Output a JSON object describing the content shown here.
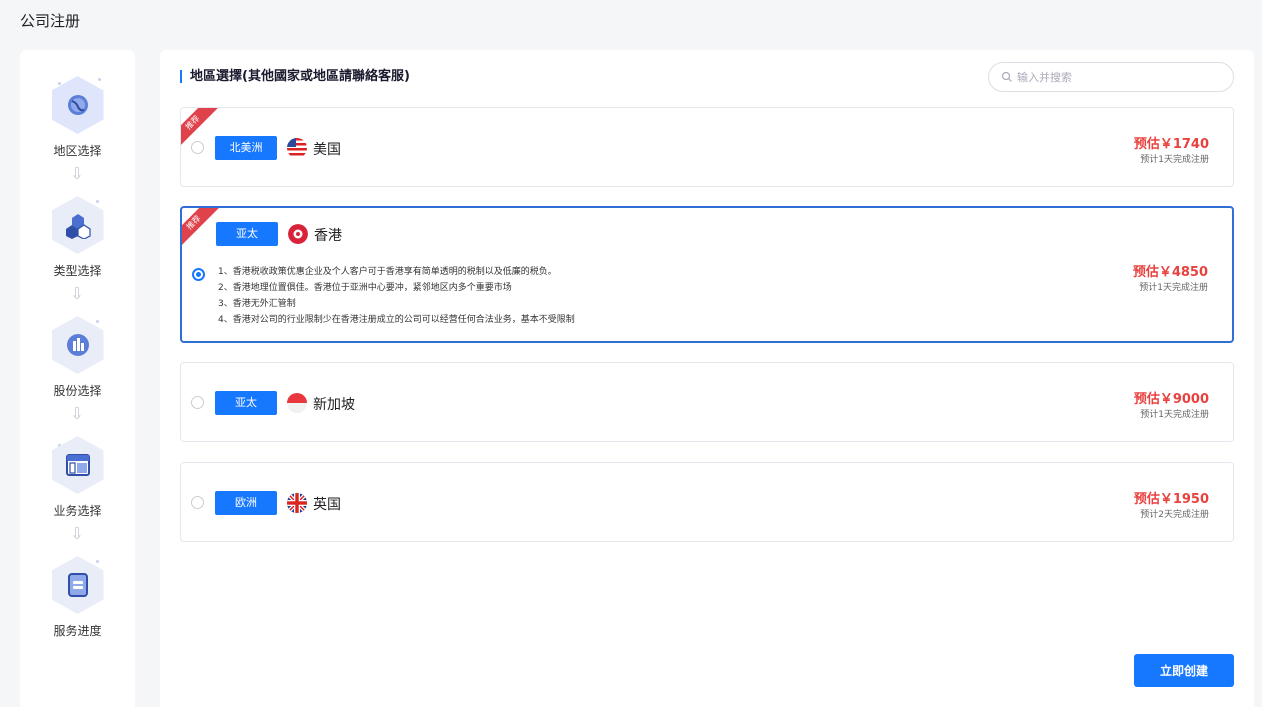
{
  "page": {
    "title": "公司注册"
  },
  "steps": [
    {
      "label": "地区选择",
      "icon": "region-icon"
    },
    {
      "label": "类型选择",
      "icon": "type-icon"
    },
    {
      "label": "股份选择",
      "icon": "shares-icon"
    },
    {
      "label": "业务选择",
      "icon": "business-icon"
    },
    {
      "label": "服务进度",
      "icon": "progress-icon"
    }
  ],
  "section": {
    "title": "地區選擇(其他國家或地區請聯絡客服)"
  },
  "search": {
    "placeholder": "输入并搜索"
  },
  "regions": [
    {
      "badge": "推荐",
      "tag": "北美洲",
      "country": "美国",
      "flag": "us-flag-icon",
      "price": "预估￥1740",
      "eta": "预计1天完成注册",
      "selected": false
    },
    {
      "badge": "推荐",
      "tag": "亚太",
      "country": "香港",
      "flag": "hk-flag-icon",
      "price": "预估￥4850",
      "eta": "预计1天完成注册",
      "selected": true,
      "description": [
        "1、香港税收政策优惠企业及个人客户可于香港享有简单透明的税制以及低廉的税负。",
        "2、香港地理位置俱佳。香港位于亚洲中心要冲，紧邻地区内多个重要市场",
        "3、香港无外汇管制",
        "4、香港对公司的行业限制少在香港注册成立的公司可以经营任何合法业务，基本不受限制"
      ]
    },
    {
      "tag": "亚太",
      "country": "新加坡",
      "flag": "sg-flag-icon",
      "price": "预估￥9000",
      "eta": "预计1天完成注册",
      "selected": false
    },
    {
      "tag": "欧洲",
      "country": "英国",
      "flag": "uk-flag-icon",
      "price": "预估￥1950",
      "eta": "预计2天完成注册",
      "selected": false
    }
  ],
  "actions": {
    "create_label": "立即创建"
  },
  "colors": {
    "primary": "#1677ff",
    "price": "#e8423f",
    "ribbon": "#e0424b"
  }
}
